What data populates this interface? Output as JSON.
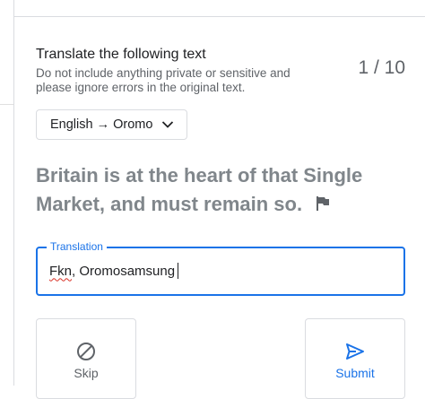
{
  "task": {
    "title": "Translate the following text",
    "subtitle": "Do not include anything private or sensitive and please ignore errors in the original text.",
    "counter": "1 / 10"
  },
  "language_selector": {
    "value": "English → Oromo",
    "icon": "chevron-down-icon"
  },
  "source": {
    "text": "Britain is at the heart of that Single Market, and must remain so.",
    "flag_icon": "flag-icon"
  },
  "translation": {
    "label": "Translation",
    "value_misspelled": "Fkn",
    "value_rest": ", Oromosamsung"
  },
  "actions": {
    "skip_label": "Skip",
    "submit_label": "Submit"
  },
  "colors": {
    "accent": "#1a73e8",
    "muted_text": "#80868b",
    "spellcheck": "#d93025"
  }
}
